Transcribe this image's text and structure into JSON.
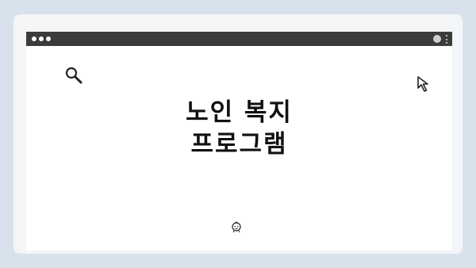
{
  "window": {
    "menu_dots_icon": "three-dots-icon",
    "profile_icon": "profile-icon"
  },
  "content": {
    "headline_line1": "노인 복지",
    "headline_line2": "프로그램",
    "icons": [
      "search-icon",
      "cursor-icon",
      "baby-icon"
    ]
  },
  "colors": {
    "background": "#d8e2ec",
    "titlebar": "#3b3b3b",
    "text": "#111111"
  }
}
